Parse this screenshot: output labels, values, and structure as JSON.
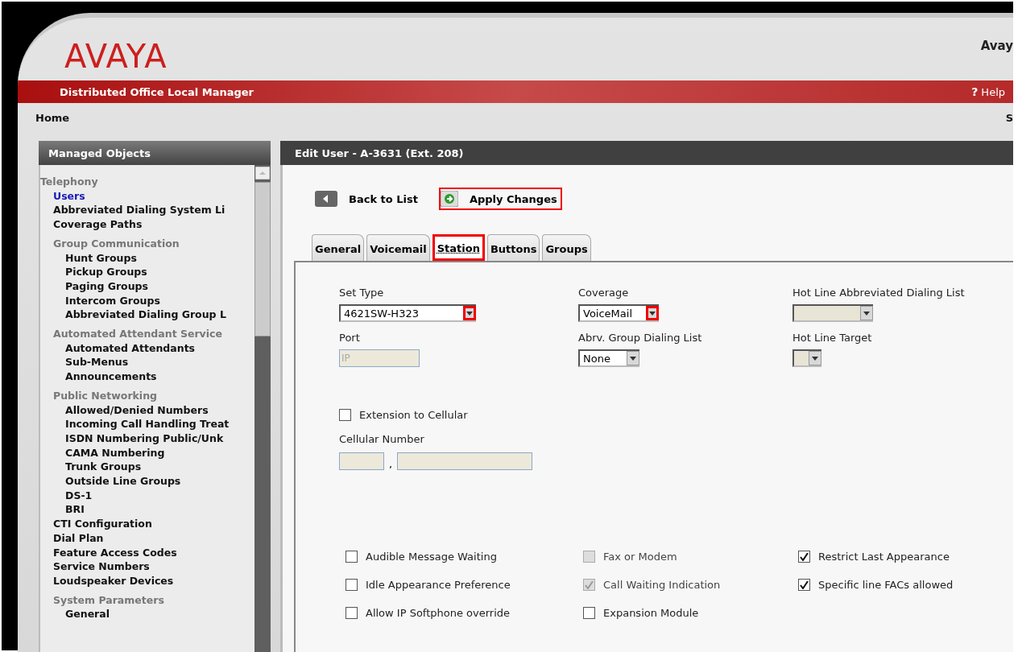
{
  "header": {
    "logo": "AVAYA",
    "user_text": "Avay",
    "product": "Distributed Office Local Manager",
    "help": {
      "icon": "?",
      "label": "Help"
    }
  },
  "nav": {
    "home": "Home",
    "right_text": "S"
  },
  "sidebar": {
    "title": "Managed Objects",
    "items": [
      {
        "label": "Telephony",
        "kind": "group",
        "children": [
          {
            "label": "Users",
            "kind": "link",
            "selected": true
          },
          {
            "label": "Abbreviated Dialing System Li",
            "kind": "link",
            "selected": false
          },
          {
            "label": "Coverage Paths",
            "kind": "link",
            "selected": false
          },
          {
            "label": "Group Communication",
            "kind": "group",
            "children": [
              {
                "label": "Hunt Groups",
                "kind": "link",
                "selected": false
              },
              {
                "label": "Pickup Groups",
                "kind": "link",
                "selected": false
              },
              {
                "label": "Paging Groups",
                "kind": "link",
                "selected": false
              },
              {
                "label": "Intercom Groups",
                "kind": "link",
                "selected": false
              },
              {
                "label": "Abbreviated Dialing Group L",
                "kind": "link",
                "selected": false
              }
            ]
          },
          {
            "label": "Automated Attendant Service",
            "kind": "group",
            "children": [
              {
                "label": "Automated Attendants",
                "kind": "link",
                "selected": false
              },
              {
                "label": "Sub-Menus",
                "kind": "link",
                "selected": false
              },
              {
                "label": "Announcements",
                "kind": "link",
                "selected": false
              }
            ]
          },
          {
            "label": "Public Networking",
            "kind": "group",
            "children": [
              {
                "label": "Allowed/Denied Numbers",
                "kind": "link",
                "selected": false
              },
              {
                "label": "Incoming Call Handling Treat",
                "kind": "link",
                "selected": false
              },
              {
                "label": "ISDN Numbering Public/Unk",
                "kind": "link",
                "selected": false
              },
              {
                "label": "CAMA Numbering",
                "kind": "link",
                "selected": false
              },
              {
                "label": "Trunk Groups",
                "kind": "link",
                "selected": false
              },
              {
                "label": "Outside Line Groups",
                "kind": "link",
                "selected": false
              },
              {
                "label": "DS-1",
                "kind": "link",
                "selected": false
              },
              {
                "label": "BRI",
                "kind": "link",
                "selected": false
              }
            ]
          },
          {
            "label": "CTI Configuration",
            "kind": "link",
            "selected": false
          },
          {
            "label": "Dial Plan",
            "kind": "link",
            "selected": false
          },
          {
            "label": "Feature Access Codes",
            "kind": "link",
            "selected": false
          },
          {
            "label": "Service Numbers",
            "kind": "link",
            "selected": false
          },
          {
            "label": "Loudspeaker Devices",
            "kind": "link",
            "selected": false
          },
          {
            "label": "System Parameters",
            "kind": "group",
            "children": [
              {
                "label": "General",
                "kind": "link",
                "selected": false
              }
            ]
          }
        ]
      }
    ]
  },
  "main": {
    "title": "Edit User - A-3631 (Ext. 208)",
    "actions": [
      {
        "label": "Back to List",
        "kind": "back",
        "highlighted": false
      },
      {
        "label": "Apply Changes",
        "kind": "apply",
        "highlighted": true
      }
    ],
    "tabs": [
      {
        "label": "General",
        "selected": false,
        "highlighted": false
      },
      {
        "label": "Voicemail",
        "selected": false,
        "highlighted": false
      },
      {
        "label": "Station",
        "selected": true,
        "highlighted": true
      },
      {
        "label": "Buttons",
        "selected": false,
        "highlighted": false
      },
      {
        "label": "Groups",
        "selected": false,
        "highlighted": false
      }
    ],
    "fields": [
      {
        "label": "Set Type",
        "kind": "select",
        "value": "4621SW-H323",
        "disabled": false,
        "highlighted": true
      },
      {
        "label": "Coverage",
        "kind": "select",
        "value": "VoiceMail",
        "disabled": false,
        "highlighted": true
      },
      {
        "label": "Hot Line Abbreviated Dialing List",
        "kind": "select",
        "disabled": true,
        "highlighted": false
      },
      {
        "label": "Port",
        "kind": "input",
        "placeholder": "IP",
        "disabled": true
      },
      {
        "label": "Abrv. Group Dialing List",
        "kind": "select",
        "value": "None",
        "disabled": false,
        "highlighted": false
      },
      {
        "label": "Hot Line Target",
        "kind": "select",
        "disabled": true,
        "highlighted": false
      }
    ],
    "extension_to_cellular": {
      "label": "Extension to Cellular",
      "checked": false,
      "disabled": false
    },
    "cellular_number": {
      "label": "Cellular Number",
      "separator": ","
    },
    "options": [
      {
        "label": "Audible Message Waiting",
        "checked": false,
        "disabled": false
      },
      {
        "label": "Fax or Modem",
        "checked": false,
        "disabled": true
      },
      {
        "label": "Restrict Last Appearance",
        "checked": true,
        "disabled": false
      },
      {
        "label": "Idle Appearance Preference",
        "checked": false,
        "disabled": false
      },
      {
        "label": "Call Waiting Indication",
        "checked": true,
        "disabled": true
      },
      {
        "label": "Specific line FACs allowed",
        "checked": true,
        "disabled": false
      },
      {
        "label": "Allow IP Softphone override",
        "checked": false,
        "disabled": false
      },
      {
        "label": "Expansion Module",
        "checked": false,
        "disabled": false
      }
    ]
  }
}
